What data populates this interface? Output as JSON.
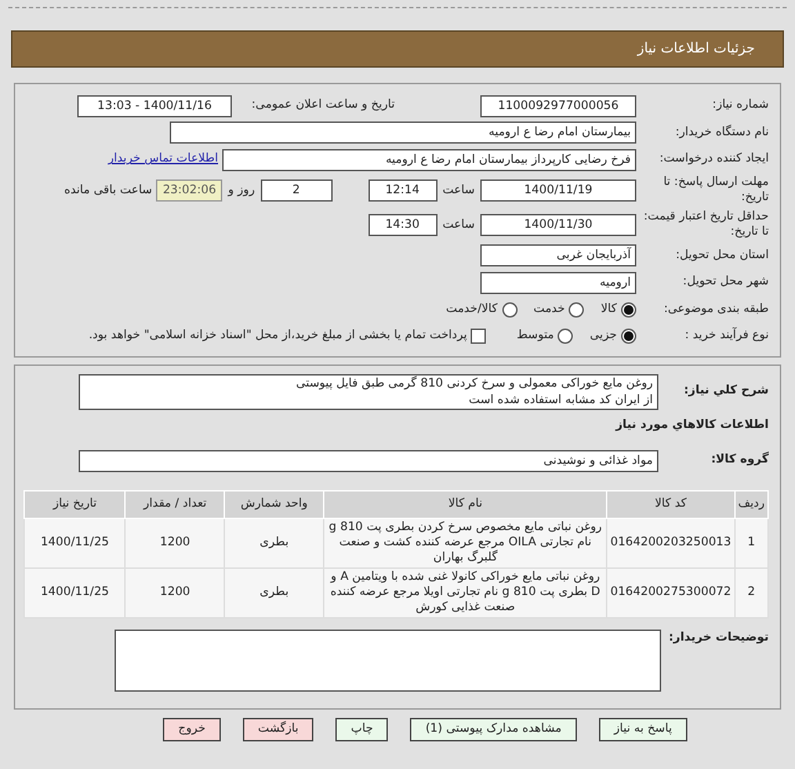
{
  "header": {
    "title": "جزئیات اطلاعات نیاز"
  },
  "need_number": {
    "label": "شماره نیاز:",
    "value": "1100092977000056"
  },
  "announce": {
    "label": "تاریخ و ساعت اعلان عمومی:",
    "value": "1400/11/16 - 13:03"
  },
  "buyer_org": {
    "label": "نام دستگاه خریدار:",
    "value": "بیمارستان امام رضا  ع  ارومیه"
  },
  "requester": {
    "label": "ایجاد کننده درخواست:",
    "value": "فرخ رضایی کارپرداز بیمارستان امام رضا  ع  ارومیه",
    "link": "اطلاعات تماس خریدار"
  },
  "deadline": {
    "label": "مهلت ارسال پاسخ: تا تاریخ:",
    "date": "1400/11/19",
    "time_label": "ساعت",
    "time": "12:14",
    "days": "2",
    "days_label": "روز و",
    "remaining": "23:02:06",
    "remaining_label": "ساعت باقی مانده"
  },
  "validity": {
    "label": "حداقل تاریخ اعتبار قیمت: تا تاریخ:",
    "date": "1400/11/30",
    "time_label": "ساعت",
    "time": "14:30"
  },
  "province": {
    "label": "استان محل تحویل:",
    "value": "آذربایجان غربی"
  },
  "city": {
    "label": "شهر محل تحویل:",
    "value": "ارومیه"
  },
  "category": {
    "label": "طبقه بندی موضوعی:",
    "options": [
      {
        "label": "کالا",
        "selected": true
      },
      {
        "label": "خدمت",
        "selected": false
      },
      {
        "label": "کالا/خدمت",
        "selected": false
      }
    ]
  },
  "process": {
    "label": "نوع فرآیند خرید :",
    "options": [
      {
        "label": "جزیی",
        "selected": true
      },
      {
        "label": "متوسط",
        "selected": false
      }
    ],
    "payment": {
      "label": "پرداخت تمام یا بخشی از مبلغ خرید،از محل \"اسناد خزانه اسلامی\" خواهد بود.",
      "checked": false
    }
  },
  "description": {
    "label": "شرح کلي نیاز:",
    "lines": [
      "روغن مایع خوراکی معمولی و سرخ کردنی 810 گرمی طبق فایل پیوستی",
      "از ایران کد مشابه استفاده شده است"
    ]
  },
  "items_title": "اطلاعات کالاهاي مورد نیاز",
  "group": {
    "label": "گروه کالا:",
    "value": "مواد غذائی و نوشیدنی"
  },
  "table": {
    "columns": [
      "ردیف",
      "کد کالا",
      "نام کالا",
      "واحد شمارش",
      "تعداد / مقدار",
      "تاریخ نیاز"
    ],
    "rows": [
      [
        "1",
        "0164200203250013",
        "روغن نباتی مایع مخصوص سرخ کردن بطری پت 810 g نام تجارتی OILA مرجع عرضه کننده کشت و صنعت گلبرگ بهاران",
        "بطری",
        "1200",
        "1400/11/25"
      ],
      [
        "2",
        "0164200275300072",
        "روغن نباتی مایع خوراکی کانولا غنی شده با ویتامین A و D بطری پت 810 g نام تجارتی اویلا مرجع عرضه کننده صنعت غذایی کورش",
        "بطری",
        "1200",
        "1400/11/25"
      ]
    ]
  },
  "buyer_notes": {
    "label": "توضیحات خریدار:"
  },
  "buttons": [
    {
      "label": "پاسخ به نیاز",
      "kind": "action"
    },
    {
      "label": "مشاهده مدارک پیوستی (1)",
      "kind": "action"
    },
    {
      "label": "چاپ",
      "kind": "action"
    },
    {
      "label": "بازگشت",
      "kind": "exit"
    },
    {
      "label": "خروج",
      "kind": "exit"
    }
  ]
}
